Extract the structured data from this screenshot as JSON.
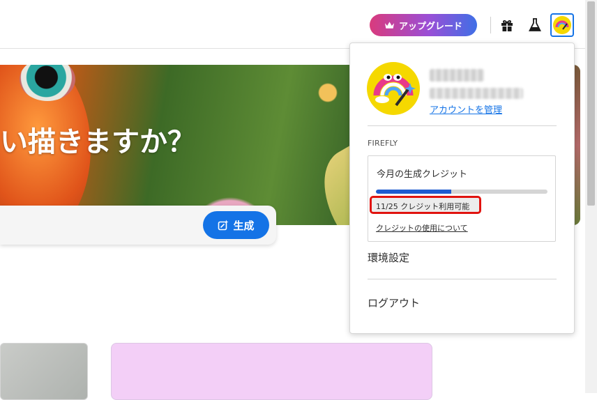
{
  "header": {
    "upgrade_label": "アップグレード",
    "icons": [
      "gift-icon",
      "flask-icon",
      "avatar"
    ]
  },
  "hero": {
    "title": "い描きますか？",
    "generate_label": "生成"
  },
  "account_menu": {
    "manage_account_label": "アカウントを管理",
    "section_label": "FIREFLY",
    "credits": {
      "title": "今月の生成クレジット",
      "used_fraction": 0.44,
      "status": "11/25 クレジット利用可能",
      "usage_link": "クレジットの使用について"
    },
    "preferences_label": "環境設定",
    "logout_label": "ログアウト"
  },
  "colors": {
    "accent": "#1473e6",
    "highlight_border": "#e1130f",
    "progress": "#1e5bd0",
    "card_pink": "#f3cff7"
  }
}
